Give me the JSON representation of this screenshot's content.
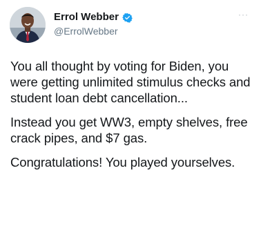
{
  "author": {
    "display_name": "Errol Webber",
    "handle": "@ErrolWebber",
    "verified_color": "#1da1f2"
  },
  "menu": {
    "more_glyph": "···"
  },
  "tweet": {
    "paragraphs": [
      "You all thought by voting for Biden, you were getting unlimited stimulus checks and student loan debt cancellation...",
      "Instead you get WW3, empty shelves, free crack pipes, and $7 gas.",
      "Congratulations! You played yourselves."
    ]
  }
}
